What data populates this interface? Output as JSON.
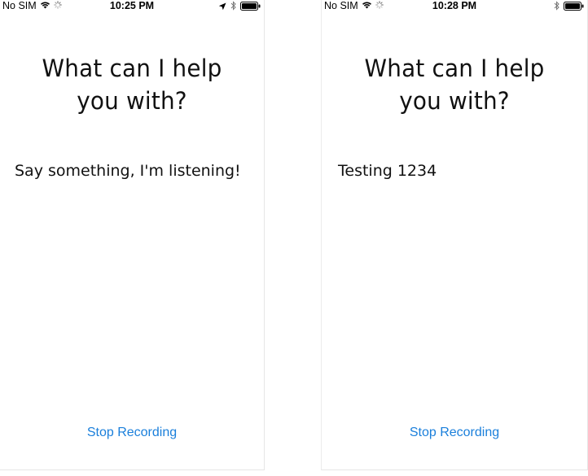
{
  "screens": [
    {
      "status": {
        "carrier": "No SIM",
        "time": "10:25 PM",
        "show_location_icon": true
      },
      "prompt": "What can I help you with?",
      "prompt_line1": "What can I help",
      "prompt_line2": "you with?",
      "transcript": "Say something, I'm listening!",
      "stop_button": "Stop Recording"
    },
    {
      "status": {
        "carrier": "No SIM",
        "time": "10:28 PM",
        "show_location_icon": false
      },
      "prompt": "What can I help you with?",
      "prompt_line1": "What can I help",
      "prompt_line2": "you with?",
      "transcript": "Testing 1234",
      "stop_button": "Stop Recording"
    }
  ],
  "colors": {
    "accent": "#1a7fdb",
    "text": "#111111",
    "background": "#ffffff"
  },
  "icons": [
    "wifi-icon",
    "activity-spinner-icon",
    "location-arrow-icon",
    "bluetooth-icon",
    "battery-icon"
  ]
}
